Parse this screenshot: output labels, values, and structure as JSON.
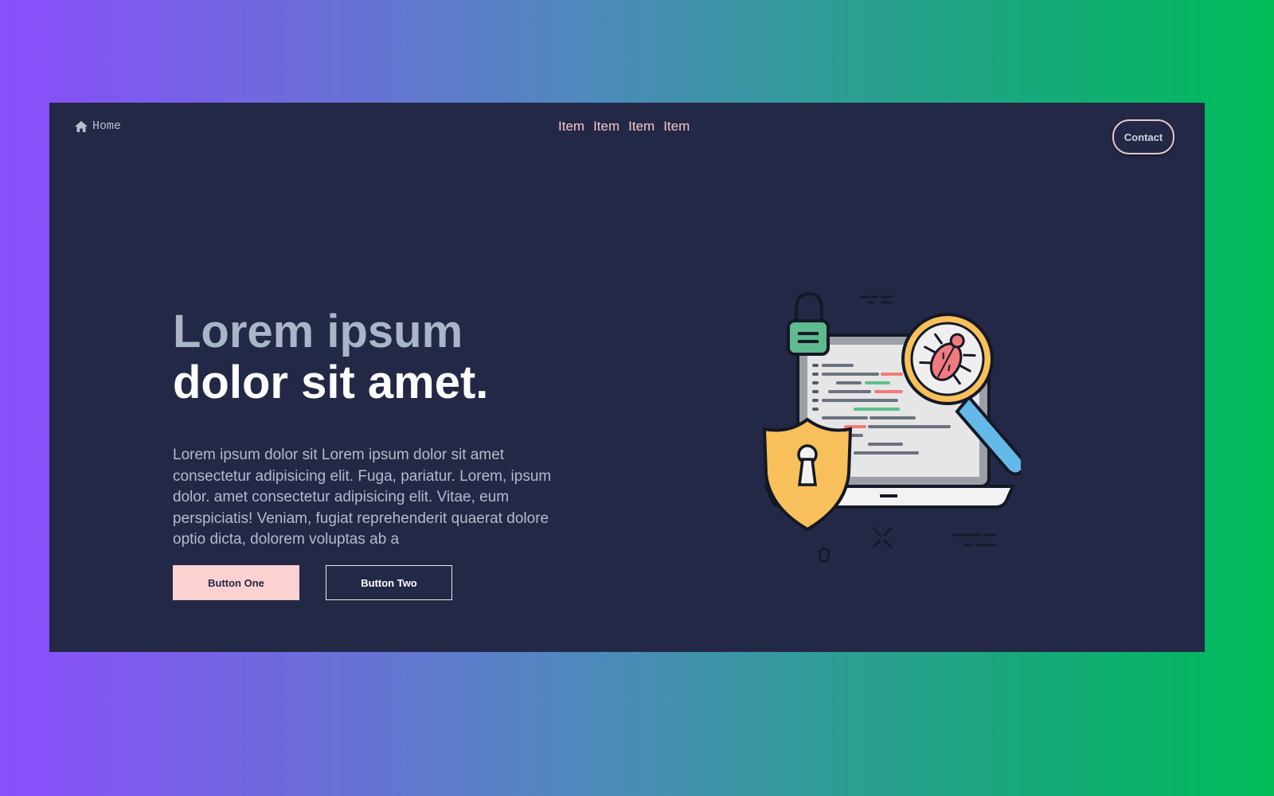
{
  "nav": {
    "home_label": "Home",
    "items": [
      "Item",
      "Item",
      "Item",
      "Item"
    ],
    "contact_label": "Contact"
  },
  "hero": {
    "headline_line1": "Lorem ipsum",
    "headline_line2": "dolor sit amet.",
    "paragraph": "Lorem ipsum dolor sit Lorem ipsum dolor sit amet consectetur adipisicing elit. Fuga, pariatur. Lorem, ipsum dolor. amet consectetur adipisicing elit. Vitae, eum perspiciatis! Veniam, fugiat reprehenderit quaerat dolore optio dicta, dolorem voluptas ab a",
    "button_one": "Button One",
    "button_two": "Button Two"
  },
  "icons": {
    "home": "home-icon",
    "illustration": "security-bug-scan-illustration"
  },
  "colors": {
    "background_gradient_start": "#8a4dfc",
    "background_gradient_end": "#00bd5a",
    "card": "#232846",
    "nav_item": "#f6c7cb",
    "button_one_bg": "#fcd1d1",
    "headline_muted": "#a9b5c8",
    "headline_bright": "#ffffff"
  }
}
